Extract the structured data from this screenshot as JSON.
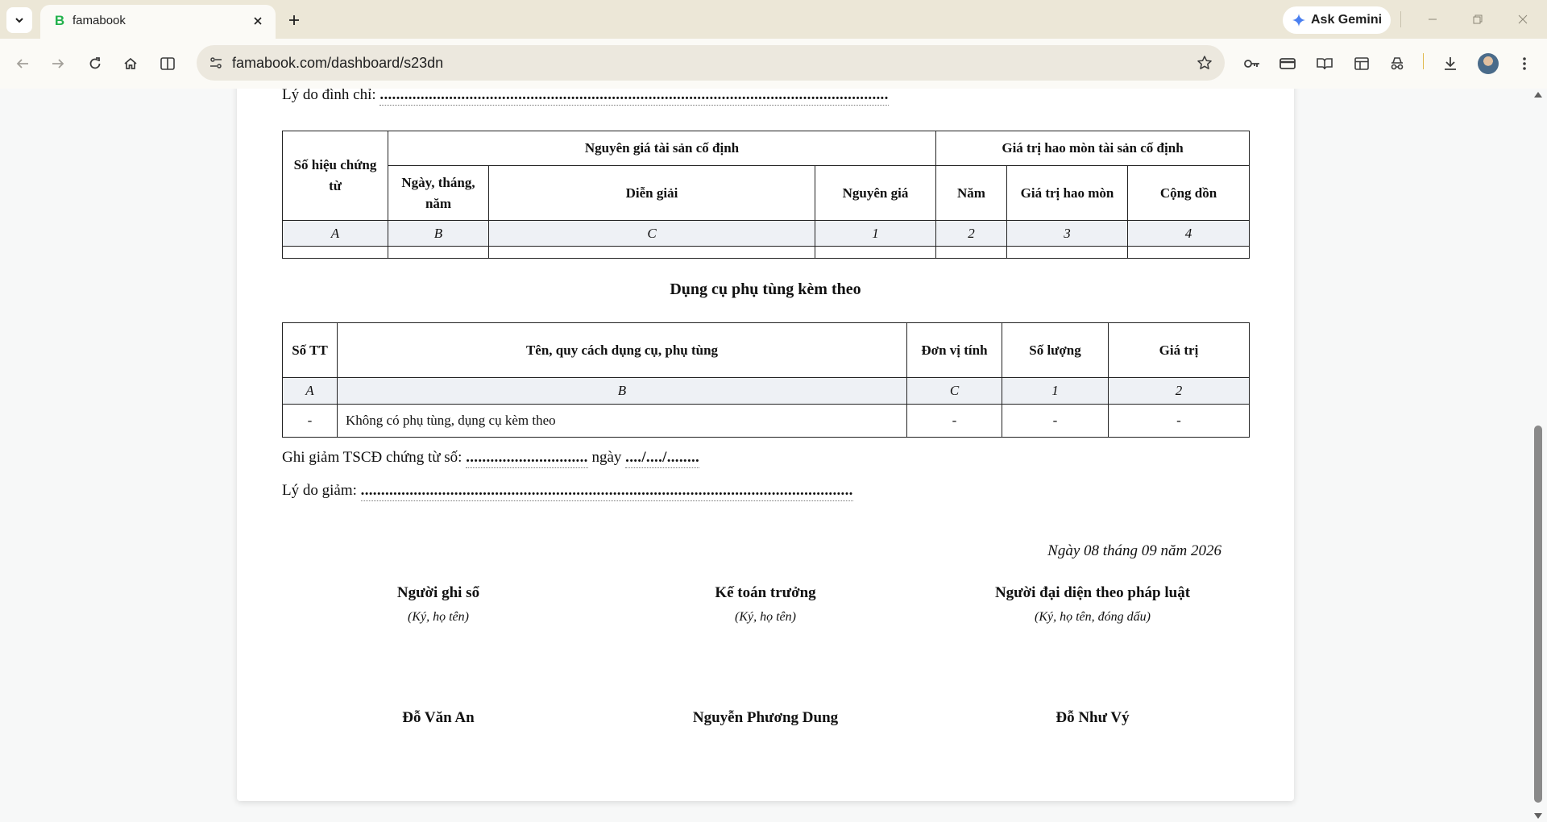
{
  "browser": {
    "tab": {
      "favicon": "B",
      "title": "famabook"
    },
    "gemini_label": "Ask Gemini",
    "url": "famabook.com/dashboard/s23dn",
    "accent_color": "#22b14c"
  },
  "doc": {
    "suspend_reason_label": "Lý do đình chỉ:",
    "suspend_reason_dots": ".............................................................................................................................",
    "table1": {
      "col_voucher": "Số hiệu chứng từ",
      "group_original": "Nguyên giá tài sản cố định",
      "group_depreciation": "Giá trị hao mòn tài sản cố định",
      "col_date": "Ngày, tháng, năm",
      "col_desc": "Diễn giải",
      "col_cost": "Nguyên giá",
      "col_year": "Năm",
      "col_dep_value": "Giá trị hao mòn",
      "col_cumulative": "Cộng dồn",
      "index": [
        "A",
        "B",
        "C",
        "1",
        "2",
        "3",
        "4"
      ]
    },
    "tools_title": "Dụng cụ phụ tùng kèm theo",
    "table2": {
      "col_no": "Số TT",
      "col_name": "Tên, quy cách dụng cụ, phụ tùng",
      "col_unit": "Đơn vị tính",
      "col_qty": "Số lượng",
      "col_value": "Giá trị",
      "index": [
        "A",
        "B",
        "C",
        "1",
        "2"
      ],
      "rows": [
        {
          "no": "-",
          "name": "Không có phụ tùng, dụng cụ kèm theo",
          "unit": "-",
          "qty": "-",
          "value": "-"
        }
      ]
    },
    "reduce_voucher_label": "Ghi giảm TSCĐ chứng từ số:",
    "reduce_voucher_dots": "..............................",
    "reduce_date_label": "ngày",
    "reduce_date_dots": "..../..../........",
    "reduce_reason_label": "Lý do giảm:",
    "reduce_reason_dots": ".........................................................................................................................",
    "date_line": "Ngày 08 tháng 09 năm 2026",
    "signers": [
      {
        "role": "Người ghi sổ",
        "note": "(Ký, họ tên)",
        "name": "Đỗ Văn An"
      },
      {
        "role": "Kế toán trưởng",
        "note": "(Ký, họ tên)",
        "name": "Nguyễn Phương Dung"
      },
      {
        "role": "Người đại diện theo pháp luật",
        "note": "(Ký, họ tên, đóng dấu)",
        "name": "Đỗ Như Vý"
      }
    ]
  }
}
